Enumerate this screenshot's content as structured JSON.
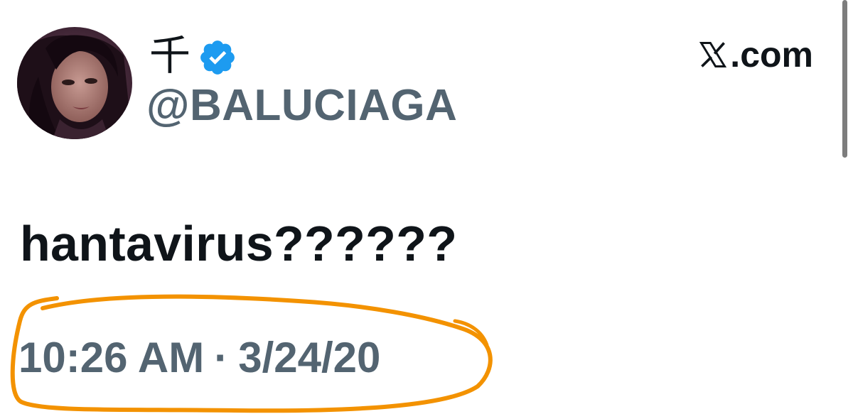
{
  "tweet": {
    "display_name": "千",
    "handle": "@BALUCIAGA",
    "text": "hantavirus??????",
    "time": "10:26 AM",
    "separator": "·",
    "date": "3/24/20",
    "verified": true
  },
  "brand": {
    "label": ".com",
    "logo_icon": "x-logo-icon"
  },
  "colors": {
    "verified_blue": "#1d9bf0",
    "handle_gray": "#536471",
    "annotation_orange": "#f39200",
    "text_black": "#0f1419"
  }
}
